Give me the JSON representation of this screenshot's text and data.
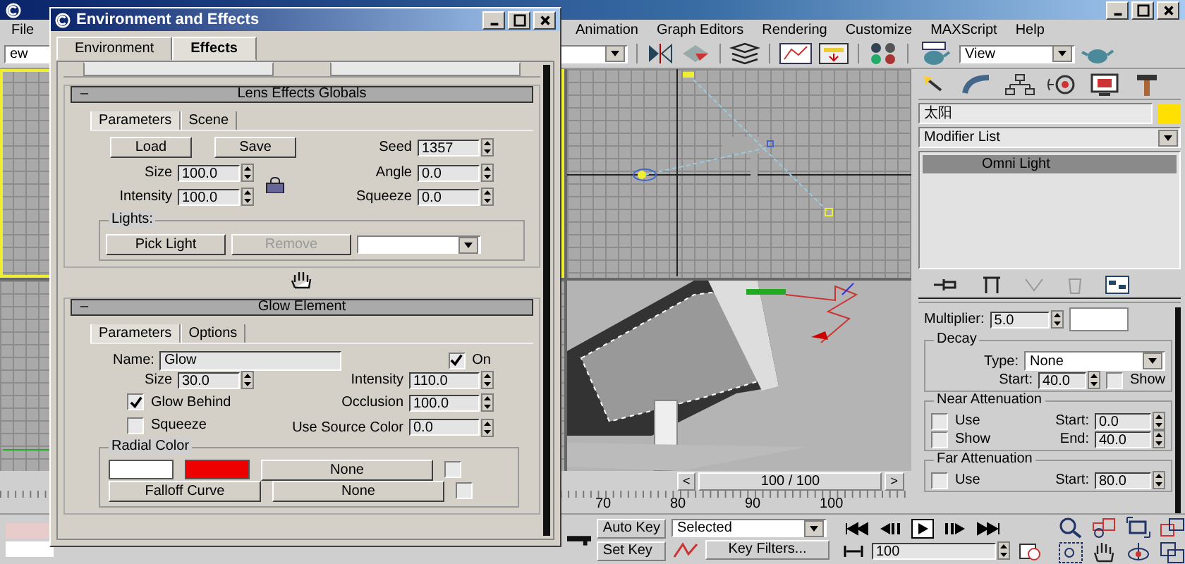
{
  "menu": {
    "left": [
      {
        "label": "File"
      }
    ],
    "right": [
      {
        "label": "Animation"
      },
      {
        "label": "Graph Editors"
      },
      {
        "label": "Rendering"
      },
      {
        "label": "Customize"
      },
      {
        "label": "MAXScript"
      },
      {
        "label": "Help"
      }
    ]
  },
  "toolbar": {
    "left_dropdown": "ew",
    "view_dropdown": "View"
  },
  "dialog": {
    "title": "Environment and Effects",
    "tabs": [
      {
        "label": "Environment",
        "selected": false
      },
      {
        "label": "Effects",
        "selected": true
      }
    ],
    "lens_globals": {
      "toggle": "–",
      "title": "Lens Effects Globals",
      "tabs": [
        {
          "label": "Parameters",
          "selected": true
        },
        {
          "label": "Scene",
          "selected": false
        }
      ],
      "load": "Load",
      "save": "Save",
      "seed": {
        "label": "Seed",
        "value": "1357"
      },
      "size": {
        "label": "Size",
        "value": "100.0"
      },
      "angle": {
        "label": "Angle",
        "value": "0.0"
      },
      "intensity": {
        "label": "Intensity",
        "value": "100.0"
      },
      "squeeze": {
        "label": "Squeeze",
        "value": "0.0"
      },
      "lights": {
        "title": "Lights:",
        "buttons": [
          {
            "label": "Pick Light",
            "disabled": false
          },
          {
            "label": "Remove",
            "disabled": true
          }
        ]
      }
    },
    "glow": {
      "toggle": "–",
      "title": "Glow Element",
      "tabs": [
        {
          "label": "Parameters",
          "selected": true
        },
        {
          "label": "Options",
          "selected": false
        }
      ],
      "name_label": "Name:",
      "name": "Glow",
      "on": {
        "label": "On",
        "checked": true
      },
      "size": {
        "label": "Size",
        "value": "30.0"
      },
      "intensity": {
        "label": "Intensity",
        "value": "110.0"
      },
      "glow_behind": {
        "label": "Glow Behind",
        "checked": true
      },
      "occlusion": {
        "label": "Occlusion",
        "value": "100.0"
      },
      "squeeze": {
        "label": "Squeeze",
        "checked": false
      },
      "use_source_color": {
        "label": "Use Source Color",
        "value": "0.0"
      },
      "radial": {
        "title": "Radial Color",
        "swatches": [
          {
            "color": "#ffffff"
          },
          {
            "color": "#ee0000"
          }
        ],
        "map": {
          "label": "None",
          "checked": false
        },
        "falloff": "Falloff Curve",
        "falloff_map": {
          "label": "None",
          "checked": false
        }
      }
    }
  },
  "command_panel": {
    "object_name": "太阳",
    "modifier_list": "Modifier List",
    "stack": [
      {
        "label": "Omni Light",
        "selected": true
      }
    ],
    "multiplier": {
      "label": "Multiplier:",
      "value": "5.0"
    },
    "decay": {
      "title": "Decay",
      "type_label": "Type:",
      "type": "None",
      "start": {
        "label": "Start:",
        "value": "40.0"
      },
      "show": {
        "label": "Show",
        "checked": false
      }
    },
    "near": {
      "title": "Near Attenuation",
      "use": {
        "label": "Use",
        "checked": false
      },
      "show": {
        "label": "Show",
        "checked": false
      },
      "start": {
        "label": "Start:",
        "value": "0.0"
      },
      "end": {
        "label": "End:",
        "value": "40.0"
      }
    },
    "far": {
      "title": "Far Attenuation",
      "use": {
        "label": "Use",
        "checked": false
      },
      "start": {
        "label": "Start:",
        "value": "80.0"
      }
    }
  },
  "timeline": {
    "prev": "<",
    "position": "100 / 100",
    "next": ">",
    "ticks": [
      "70",
      "80",
      "90",
      "100"
    ]
  },
  "animation": {
    "auto_key": "Auto Key",
    "set_key": "Set Key",
    "selection": "Selected",
    "key_filters": "Key Filters...",
    "frame": "100"
  }
}
